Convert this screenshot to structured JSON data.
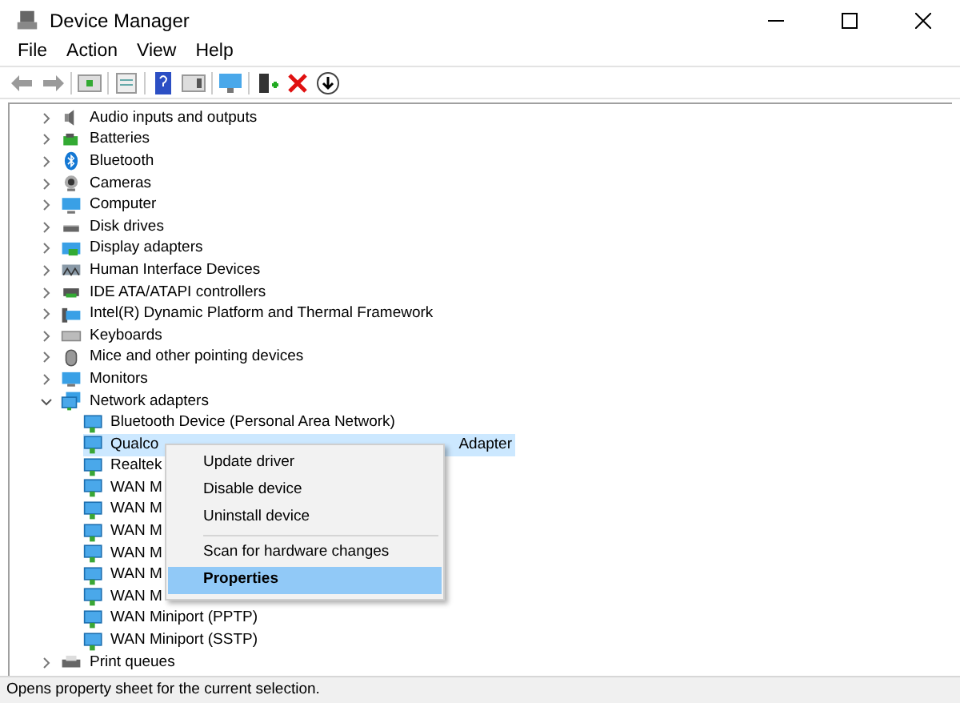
{
  "window": {
    "title": "Device Manager"
  },
  "menu_bar": [
    "File",
    "Action",
    "View",
    "Help"
  ],
  "tree": [
    {
      "label": "Audio inputs and outputs",
      "expanded": false
    },
    {
      "label": "Batteries",
      "expanded": false
    },
    {
      "label": "Bluetooth",
      "expanded": false
    },
    {
      "label": "Cameras",
      "expanded": false
    },
    {
      "label": "Computer",
      "expanded": false
    },
    {
      "label": "Disk drives",
      "expanded": false
    },
    {
      "label": "Display adapters",
      "expanded": false
    },
    {
      "label": "Human Interface Devices",
      "expanded": false
    },
    {
      "label": "IDE ATA/ATAPI controllers",
      "expanded": false
    },
    {
      "label": "Intel(R) Dynamic Platform and Thermal Framework",
      "expanded": false
    },
    {
      "label": "Keyboards",
      "expanded": false
    },
    {
      "label": "Mice and other pointing devices",
      "expanded": false
    },
    {
      "label": "Monitors",
      "expanded": false
    },
    {
      "label": "Network adapters",
      "expanded": true,
      "children": [
        {
          "label": "Bluetooth Device (Personal Area Network)",
          "selected": false
        },
        {
          "label": "Qualco",
          "label_tail": "Adapter",
          "selected": true
        },
        {
          "label": "Realtek",
          "selected": false
        },
        {
          "label": "WAN M",
          "selected": false
        },
        {
          "label": "WAN M",
          "selected": false
        },
        {
          "label": "WAN M",
          "selected": false
        },
        {
          "label": "WAN M",
          "selected": false
        },
        {
          "label": "WAN M",
          "selected": false
        },
        {
          "label": "WAN M",
          "selected": false
        },
        {
          "label": "WAN Miniport (PPTP)",
          "selected": false
        },
        {
          "label": "WAN Miniport (SSTP)",
          "selected": false
        }
      ]
    },
    {
      "label": "Print queues",
      "expanded": false
    }
  ],
  "context_menu": [
    {
      "kind": "item",
      "label": "Update driver",
      "selected": false
    },
    {
      "kind": "item",
      "label": "Disable device",
      "selected": false
    },
    {
      "kind": "item",
      "label": "Uninstall device",
      "selected": false
    },
    {
      "kind": "separator"
    },
    {
      "kind": "item",
      "label": "Scan for hardware changes",
      "selected": false
    },
    {
      "kind": "item",
      "label": "Properties",
      "selected": true,
      "bold": true
    }
  ],
  "status_bar": "Opens property sheet for the current selection."
}
